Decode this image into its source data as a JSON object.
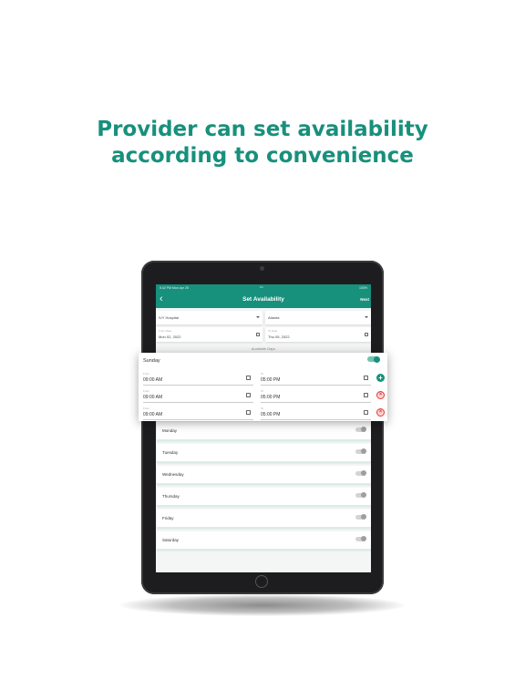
{
  "headline": {
    "line1": "Provider can set availability",
    "line2": "according to convenience"
  },
  "status_bar": {
    "time": "5:42 PM  Mon Apr 25",
    "dots": "•••",
    "battery": "100%"
  },
  "nav": {
    "back_icon": "chevron-left-icon",
    "title": "Set Availability",
    "next_label": "Next"
  },
  "form": {
    "hospital": "IVY Hospital",
    "city": "Atlanta",
    "from_label": "From Date",
    "from_date": "Mon 02, 2022",
    "to_label": "To Date",
    "to_date": "Thu 05, 2022"
  },
  "available_days_label": "Available Days",
  "sunday": {
    "label": "Sunday",
    "enabled": true,
    "from_label": "From",
    "to_label": "To",
    "slots": [
      {
        "from": "09:00 AM",
        "to": "05:00 PM",
        "action": "add"
      },
      {
        "from": "09:00 AM",
        "to": "05:00 PM",
        "action": "remove"
      },
      {
        "from": "09:00 AM",
        "to": "05:00 PM",
        "action": "remove"
      }
    ]
  },
  "days": [
    {
      "label": "Monday",
      "enabled": false
    },
    {
      "label": "Tuesday",
      "enabled": false
    },
    {
      "label": "Wednesday",
      "enabled": false
    },
    {
      "label": "Thursday",
      "enabled": false
    },
    {
      "label": "Friday",
      "enabled": false
    },
    {
      "label": "Saturday",
      "enabled": false
    }
  ],
  "colors": {
    "brand": "#17907c",
    "remove": "#e53935"
  }
}
